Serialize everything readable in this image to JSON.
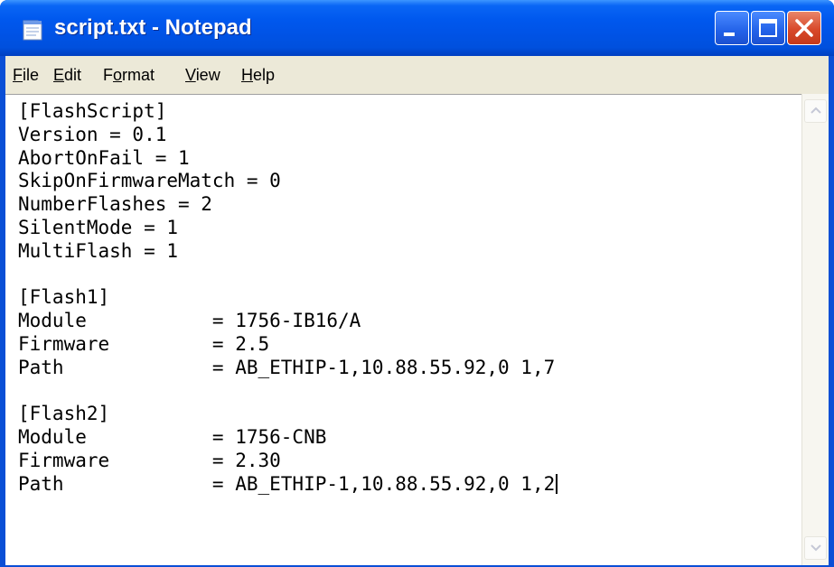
{
  "window": {
    "title": "script.txt - Notepad",
    "colors": {
      "titlebar": "#0058ee",
      "menubar": "#ece9d8",
      "close_button": "#d8492a",
      "edit_background": "#ffffff"
    }
  },
  "menubar": {
    "items": [
      {
        "accel": "F",
        "rest": "ile"
      },
      {
        "accel": "E",
        "rest": "dit"
      },
      {
        "pre": "F",
        "accel": "o",
        "rest": "rmat"
      },
      {
        "accel": "V",
        "rest": "iew"
      },
      {
        "accel": "H",
        "rest": "elp"
      }
    ]
  },
  "editor": {
    "text": "[FlashScript]\nVersion = 0.1\nAbortOnFail = 1\nSkipOnFirmwareMatch = 0\nNumberFlashes = 2\nSilentMode = 1\nMultiFlash = 1\n\n[Flash1]\nModule           = 1756-IB16/A\nFirmware         = 2.5\nPath             = AB_ETHIP-1,10.88.55.92,0 1,7\n\n[Flash2]\nModule           = 1756-CNB\nFirmware         = 2.30\nPath             = AB_ETHIP-1,10.88.55.92,0 1,2"
  },
  "icons": {
    "app": "notepad-icon",
    "minimize": "minimize-icon",
    "maximize": "maximize-icon",
    "close": "close-icon",
    "scroll_up": "arrow-up-icon",
    "scroll_down": "arrow-down-icon"
  }
}
